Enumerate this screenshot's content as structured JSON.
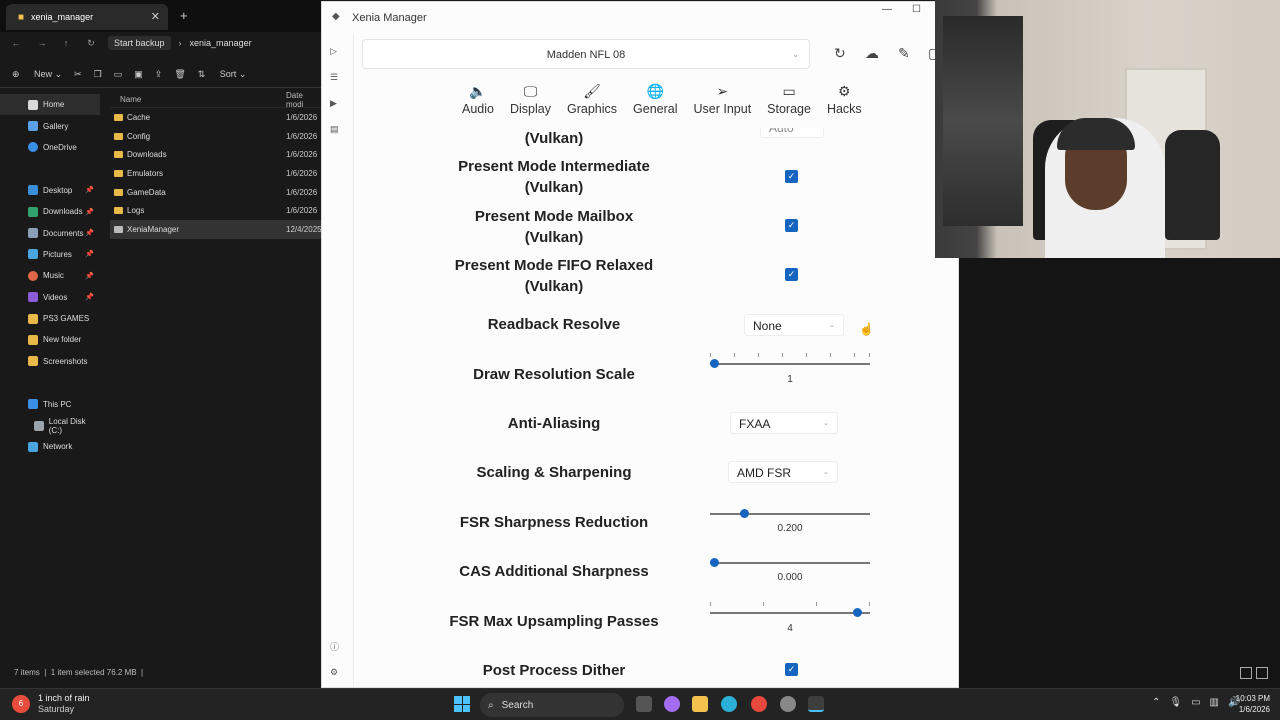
{
  "explorer": {
    "tab_title": "xenia_manager",
    "address": {
      "start_backup": "Start backup",
      "folder": "xenia_manager"
    },
    "toolbar": {
      "new_label": "New",
      "sort_label": "Sort"
    },
    "nav": [
      "Home",
      "Gallery",
      "OneDrive",
      "Desktop",
      "Downloads",
      "Documents",
      "Pictures",
      "Music",
      "Videos",
      "PS3 GAMES",
      "New folder",
      "Screenshots",
      "This PC",
      "Local Disk (C:)",
      "Network"
    ],
    "columns": {
      "name": "Name",
      "date": "Date modi"
    },
    "files": [
      {
        "name": "Cache",
        "date": "1/6/2026"
      },
      {
        "name": "Config",
        "date": "1/6/2026"
      },
      {
        "name": "Downloads",
        "date": "1/6/2026"
      },
      {
        "name": "Emulators",
        "date": "1/6/2026"
      },
      {
        "name": "GameData",
        "date": "1/6/2026"
      },
      {
        "name": "Logs",
        "date": "1/6/2026"
      },
      {
        "name": "XeniaManager",
        "date": "12/4/2025"
      }
    ],
    "status": {
      "items": "7 items",
      "selected": "1 item selected  76.2 MB"
    }
  },
  "xenia": {
    "title": "Xenia Manager",
    "game": "Madden NFL 08",
    "tabs": [
      {
        "label": "Audio",
        "icon": "audio-icon"
      },
      {
        "label": "Display",
        "icon": "display-icon"
      },
      {
        "label": "Graphics",
        "icon": "graphics-icon"
      },
      {
        "label": "General",
        "icon": "globe-icon"
      },
      {
        "label": "User Input",
        "icon": "cursor-icon"
      },
      {
        "label": "Storage",
        "icon": "storage-icon"
      },
      {
        "label": "Hacks",
        "icon": "gear-icon"
      }
    ],
    "settings": {
      "partial_label": "(Vulkan)",
      "partial_value": "Auto",
      "present_intermediate": "Present Mode Intermediate\n(Vulkan)",
      "present_mailbox": "Present Mode Mailbox\n(Vulkan)",
      "present_fifo": "Present Mode FIFO Relaxed\n(Vulkan)",
      "readback_resolve": "Readback Resolve",
      "readback_value": "None",
      "draw_resolution_scale": "Draw Resolution Scale",
      "draw_resolution_value": "1",
      "anti_aliasing": "Anti-Aliasing",
      "anti_aliasing_value": "FXAA",
      "scaling": "Scaling & Sharpening",
      "scaling_value": "AMD FSR",
      "fsr_sharpness": "FSR Sharpness Reduction",
      "fsr_sharpness_value": "0.200",
      "cas_sharpness": "CAS Additional Sharpness",
      "cas_sharpness_value": "0.000",
      "fsr_passes": "FSR Max Upsampling Passes",
      "fsr_passes_value": "4",
      "post_dither": "Post Process Dither"
    },
    "slider_levels": {
      "draw_resolution": 0.0,
      "fsr_sharpness": 0.2,
      "cas_sharpness": 0.0,
      "fsr_passes": 0.95
    }
  },
  "taskbar": {
    "weather": {
      "line1": "1 inch of rain",
      "line2": "Saturday",
      "badge": "6"
    },
    "search": "Search",
    "clock": {
      "time": "10:03 PM",
      "date": "1/6/2026"
    }
  },
  "colors": {
    "accent": "#1565c0",
    "folder": "#e8b848"
  }
}
